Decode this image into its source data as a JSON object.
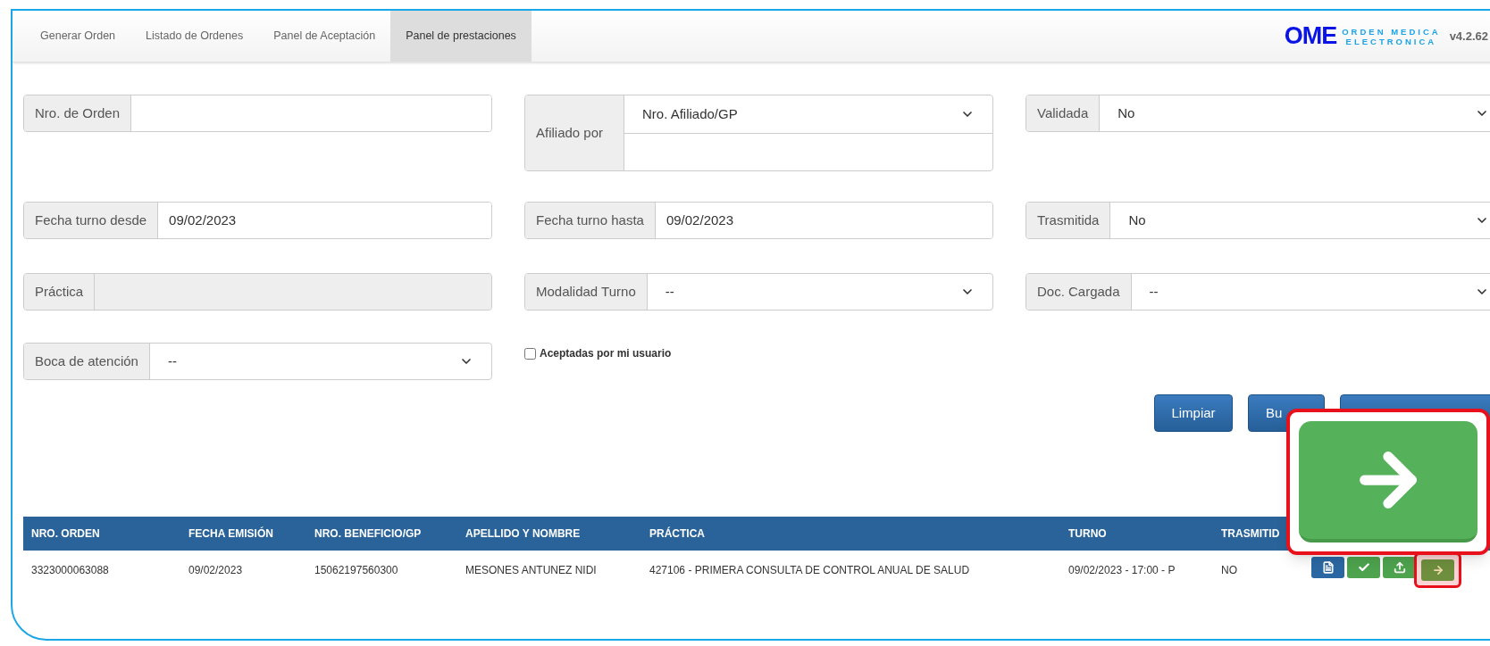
{
  "tabs": [
    {
      "label": "Generar Orden",
      "selected": false
    },
    {
      "label": "Listado de Ordenes",
      "selected": false
    },
    {
      "label": "Panel de Aceptación",
      "selected": false
    },
    {
      "label": "Panel de prestaciones",
      "selected": true
    }
  ],
  "logo": {
    "mark": "OME",
    "line_1": "ORDEN MEDICA",
    "line_2": "ELECTRONICA"
  },
  "version": "v4.2.62",
  "filters": {
    "nro_orden": {
      "label": "Nro. de Orden"
    },
    "afiliado_por": {
      "label": "Afiliado por",
      "select": "Nro. Afiliado/GP"
    },
    "validada": {
      "label": "Validada",
      "select": "No"
    },
    "fecha_desde": {
      "label": "Fecha turno desde",
      "value": "09/02/2023"
    },
    "fecha_hasta": {
      "label": "Fecha turno hasta",
      "value": "09/02/2023"
    },
    "trasmitida": {
      "label": "Trasmitida",
      "select": "No"
    },
    "practica": {
      "label": "Práctica",
      "disabled": true
    },
    "modalidad": {
      "label": "Modalidad Turno",
      "select": "--"
    },
    "doc_cargada": {
      "label": "Doc. Cargada",
      "select": "--"
    },
    "boca": {
      "label": "Boca de atención",
      "select": "--"
    },
    "aceptadas": {
      "label": "Aceptadas por mi usuario",
      "checked": false
    }
  },
  "buttons": [
    {
      "kind": "primary",
      "label": "Limpiar"
    },
    {
      "kind": "primary",
      "label": "Bu"
    },
    {
      "kind": "primary"
    }
  ],
  "table": {
    "columns": [
      "NRO. ORDEN",
      "FECHA EMISIÓN",
      "NRO. BENEFICIO/GP",
      "APELLIDO Y NOMBRE",
      "PRÁCTICA",
      "TURNO",
      "TRASMITID"
    ],
    "rows": [
      {
        "cells": [
          "3323000063088",
          "09/02/2023",
          "15062197560300",
          "MESONES ANTUNEZ NIDI",
          "427106 - PRIMERA CONSULTA DE CONTROL ANUAL DE SALUD",
          "09/02/2023 - 17:00 - P",
          "NO"
        ],
        "actions": [
          {
            "kind": "document",
            "highlighted": false
          },
          {
            "kind": "check",
            "highlighted": false
          },
          {
            "kind": "upload",
            "highlighted": false
          },
          {
            "kind": "forward",
            "highlighted": true
          }
        ]
      }
    ]
  },
  "callout": {
    "kind": "forward"
  }
}
